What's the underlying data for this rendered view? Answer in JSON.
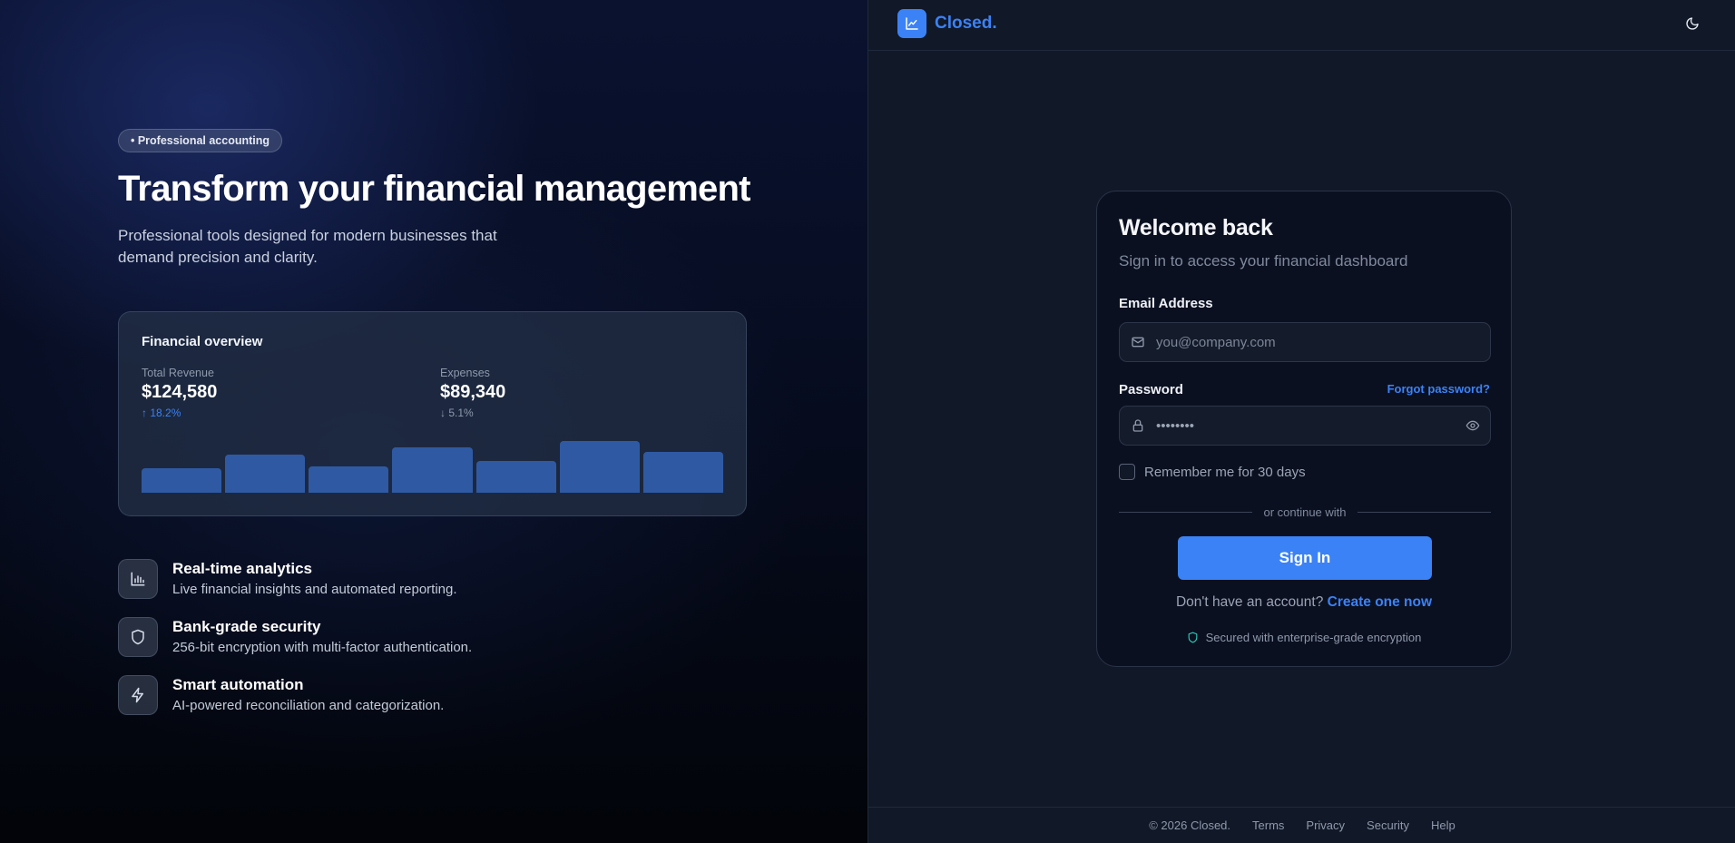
{
  "brand": {
    "name": "Closed."
  },
  "hero": {
    "badge": "• Professional accounting",
    "title": "Transform your financial management",
    "subtitle": "Professional tools designed for modern businesses that demand precision and clarity."
  },
  "overview": {
    "title": "Financial overview",
    "revenue": {
      "label": "Total Revenue",
      "value": "$124,580",
      "change": "↑ 18.2%"
    },
    "expenses": {
      "label": "Expenses",
      "value": "$89,340",
      "change": "↓ 5.1%"
    },
    "bars": [
      0.38,
      0.6,
      0.42,
      0.72,
      0.5,
      0.82,
      0.64
    ]
  },
  "features": [
    {
      "title": "Real-time analytics",
      "desc": "Live financial insights and automated reporting.",
      "icon": "bar-chart-icon"
    },
    {
      "title": "Bank-grade security",
      "desc": "256-bit encryption with multi-factor authentication.",
      "icon": "shield-icon"
    },
    {
      "title": "Smart automation",
      "desc": "AI-powered reconciliation and categorization.",
      "icon": "lightning-icon"
    }
  ],
  "login": {
    "title": "Welcome back",
    "subtitle": "Sign in to access your financial dashboard",
    "email_label": "Email Address",
    "email_placeholder": "you@company.com",
    "password_label": "Password",
    "forgot": "Forgot password?",
    "password_value": "••••••••",
    "remember": "Remember me for 30 days",
    "divider": "or continue with",
    "signin": "Sign In",
    "signup_text": "Don't have an account?",
    "signup_link": "Create one now",
    "secured": "Secured with enterprise-grade encryption"
  },
  "footer": {
    "copyright": "© 2026 Closed.",
    "links": [
      "Terms",
      "Privacy",
      "Security",
      "Help"
    ]
  },
  "colors": {
    "accent": "#3b82f6",
    "bar": "#2f5aa3",
    "card_bg": "#0b1020",
    "page_bg": "#111827"
  }
}
